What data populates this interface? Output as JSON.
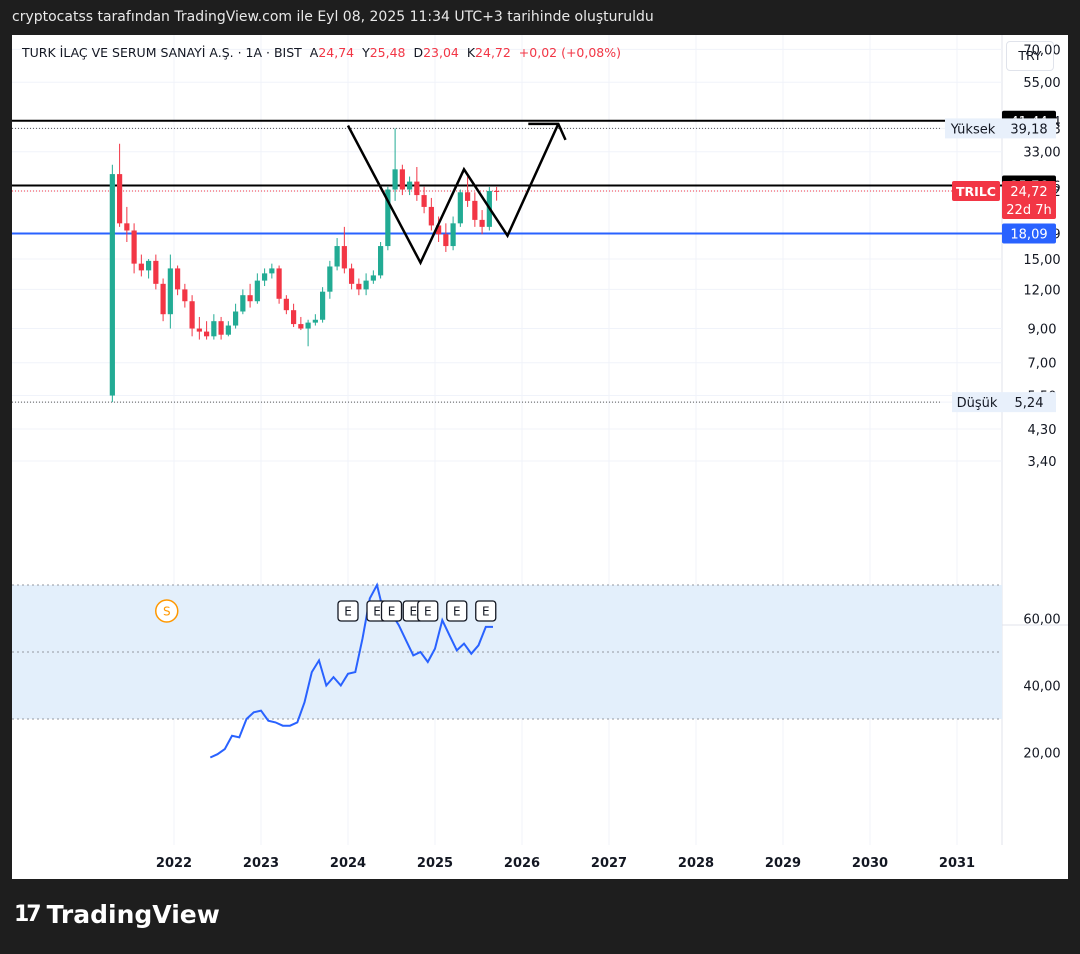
{
  "header": {
    "text": "cryptocatss tarafından TradingView.com ile Eyl 08, 2025 11:34 UTC+3 tarihinde oluşturuldu"
  },
  "legend": {
    "symbol": "TURK İLAÇ VE SERUM SANAYİ A.Ş. · 1A · BIST",
    "a_label": "A",
    "a_val": "24,74",
    "y_label": "Y",
    "y_val": "25,48",
    "d_label": "D",
    "d_val": "23,04",
    "k_label": "K",
    "k_val": "24,72",
    "change": "+0,02 (+0,08%)"
  },
  "currency": "TRY",
  "logo": {
    "mark": "17",
    "text": "TradingView"
  },
  "colors": {
    "up": "#22ab94",
    "down": "#f23645",
    "rsi": "#2962ff",
    "level": "#2962ff",
    "band": "#e3effb"
  },
  "chart_data": [
    {
      "type": "candlestick",
      "title": "TURK İLAÇ VE SERUM SANAYİ A.Ş. · 1A · BIST",
      "interval": "1A",
      "scale": "log",
      "currency": "TRY",
      "y_ticks": [
        "70,00",
        "55,00",
        "41,44",
        "39,18",
        "33,00",
        "25,76",
        "24,72",
        "18,09",
        "15,00",
        "12,00",
        "9,00",
        "7,00",
        "5,50",
        "5,24",
        "4,30",
        "3,40"
      ],
      "x_ticks": [
        "2022",
        "2023",
        "2024",
        "2025",
        "2026",
        "2027",
        "2028",
        "2029",
        "2030",
        "2031"
      ],
      "candles": [
        {
          "t": "2021-04",
          "o": 5.5,
          "h": 30.0,
          "l": 5.24,
          "c": 28.0
        },
        {
          "t": "2021-05",
          "o": 28.0,
          "h": 35.0,
          "l": 19.0,
          "c": 19.5
        },
        {
          "t": "2021-06",
          "o": 19.5,
          "h": 22.0,
          "l": 17.0,
          "c": 18.5
        },
        {
          "t": "2021-07",
          "o": 18.5,
          "h": 19.5,
          "l": 13.5,
          "c": 14.5
        },
        {
          "t": "2021-08",
          "o": 14.5,
          "h": 15.5,
          "l": 13.2,
          "c": 13.8
        },
        {
          "t": "2021-09",
          "o": 13.8,
          "h": 15.0,
          "l": 13.0,
          "c": 14.8
        },
        {
          "t": "2021-10",
          "o": 14.8,
          "h": 15.5,
          "l": 12.0,
          "c": 12.5
        },
        {
          "t": "2021-11",
          "o": 12.5,
          "h": 13.0,
          "l": 9.5,
          "c": 10.0
        },
        {
          "t": "2021-12",
          "o": 10.0,
          "h": 15.5,
          "l": 9.0,
          "c": 14.0
        },
        {
          "t": "2022-01",
          "o": 14.0,
          "h": 14.3,
          "l": 11.5,
          "c": 12.0
        },
        {
          "t": "2022-02",
          "o": 12.0,
          "h": 12.5,
          "l": 10.5,
          "c": 11.0
        },
        {
          "t": "2022-03",
          "o": 11.0,
          "h": 11.5,
          "l": 8.5,
          "c": 9.0
        },
        {
          "t": "2022-04",
          "o": 9.0,
          "h": 9.8,
          "l": 8.3,
          "c": 8.8
        },
        {
          "t": "2022-05",
          "o": 8.8,
          "h": 9.5,
          "l": 8.3,
          "c": 8.5
        },
        {
          "t": "2022-06",
          "o": 8.5,
          "h": 10.0,
          "l": 8.3,
          "c": 9.5
        },
        {
          "t": "2022-07",
          "o": 9.5,
          "h": 9.8,
          "l": 8.3,
          "c": 8.6
        },
        {
          "t": "2022-08",
          "o": 8.6,
          "h": 9.5,
          "l": 8.5,
          "c": 9.2
        },
        {
          "t": "2022-09",
          "o": 9.2,
          "h": 10.8,
          "l": 9.0,
          "c": 10.2
        },
        {
          "t": "2022-10",
          "o": 10.2,
          "h": 12.0,
          "l": 10.0,
          "c": 11.5
        },
        {
          "t": "2022-11",
          "o": 11.5,
          "h": 12.5,
          "l": 10.5,
          "c": 11.0
        },
        {
          "t": "2022-12",
          "o": 11.0,
          "h": 13.5,
          "l": 10.8,
          "c": 12.8
        },
        {
          "t": "2023-01",
          "o": 12.8,
          "h": 14.0,
          "l": 12.3,
          "c": 13.5
        },
        {
          "t": "2023-02",
          "o": 13.5,
          "h": 14.5,
          "l": 13.0,
          "c": 14.0
        },
        {
          "t": "2023-03",
          "o": 14.0,
          "h": 14.3,
          "l": 10.8,
          "c": 11.2
        },
        {
          "t": "2023-04",
          "o": 11.2,
          "h": 11.5,
          "l": 10.0,
          "c": 10.3
        },
        {
          "t": "2023-05",
          "o": 10.3,
          "h": 10.8,
          "l": 9.1,
          "c": 9.3
        },
        {
          "t": "2023-06",
          "o": 9.3,
          "h": 9.8,
          "l": 8.9,
          "c": 9.0
        },
        {
          "t": "2023-07",
          "o": 9.0,
          "h": 9.6,
          "l": 7.9,
          "c": 9.4
        },
        {
          "t": "2023-08",
          "o": 9.4,
          "h": 10.0,
          "l": 9.2,
          "c": 9.6
        },
        {
          "t": "2023-09",
          "o": 9.6,
          "h": 12.2,
          "l": 9.4,
          "c": 11.8
        },
        {
          "t": "2023-10",
          "o": 11.8,
          "h": 14.8,
          "l": 11.2,
          "c": 14.2
        },
        {
          "t": "2023-11",
          "o": 14.2,
          "h": 17.5,
          "l": 13.8,
          "c": 16.5
        },
        {
          "t": "2023-12",
          "o": 16.5,
          "h": 19.0,
          "l": 13.5,
          "c": 14.0
        },
        {
          "t": "2024-01",
          "o": 14.0,
          "h": 14.5,
          "l": 12.0,
          "c": 12.5
        },
        {
          "t": "2024-02",
          "o": 12.5,
          "h": 13.0,
          "l": 11.5,
          "c": 12.0
        },
        {
          "t": "2024-03",
          "o": 12.0,
          "h": 13.5,
          "l": 11.5,
          "c": 12.8
        },
        {
          "t": "2024-04",
          "o": 12.8,
          "h": 13.8,
          "l": 12.5,
          "c": 13.3
        },
        {
          "t": "2024-05",
          "o": 13.3,
          "h": 17.0,
          "l": 13.0,
          "c": 16.5
        },
        {
          "t": "2024-06",
          "o": 16.5,
          "h": 25.5,
          "l": 16.0,
          "c": 25.0
        },
        {
          "t": "2024-07",
          "o": 25.0,
          "h": 39.18,
          "l": 23.0,
          "c": 29.0
        },
        {
          "t": "2024-08",
          "o": 29.0,
          "h": 30.0,
          "l": 24.0,
          "c": 25.0
        },
        {
          "t": "2024-09",
          "o": 25.0,
          "h": 27.5,
          "l": 24.0,
          "c": 26.5
        },
        {
          "t": "2024-10",
          "o": 26.5,
          "h": 29.5,
          "l": 23.0,
          "c": 24.0
        },
        {
          "t": "2024-11",
          "o": 24.0,
          "h": 25.5,
          "l": 21.0,
          "c": 22.0
        },
        {
          "t": "2024-12",
          "o": 22.0,
          "h": 23.5,
          "l": 18.5,
          "c": 19.2
        },
        {
          "t": "2025-01",
          "o": 19.2,
          "h": 20.5,
          "l": 17.0,
          "c": 18.0
        },
        {
          "t": "2025-02",
          "o": 18.0,
          "h": 19.5,
          "l": 15.8,
          "c": 16.5
        },
        {
          "t": "2025-03",
          "o": 16.5,
          "h": 20.5,
          "l": 16.0,
          "c": 19.5
        },
        {
          "t": "2025-04",
          "o": 19.5,
          "h": 25.0,
          "l": 19.0,
          "c": 24.5
        },
        {
          "t": "2025-05",
          "o": 24.5,
          "h": 27.5,
          "l": 22.0,
          "c": 23.0
        },
        {
          "t": "2025-06",
          "o": 23.0,
          "h": 24.5,
          "l": 19.0,
          "c": 20.0
        },
        {
          "t": "2025-07",
          "o": 20.0,
          "h": 21.5,
          "l": 18.0,
          "c": 19.0
        },
        {
          "t": "2025-08",
          "o": 19.0,
          "h": 25.48,
          "l": 18.5,
          "c": 24.74
        },
        {
          "t": "2025-09",
          "o": 24.74,
          "h": 25.48,
          "l": 23.04,
          "c": 24.72
        }
      ],
      "horizontal_lines": [
        {
          "value": 41.44,
          "label": "41,44",
          "color": "#000000"
        },
        {
          "value": 25.76,
          "label": "25,76",
          "color": "#000000"
        },
        {
          "value": 18.09,
          "label": "18,09",
          "color": "#2962ff"
        }
      ],
      "high_low": {
        "high_label": "Yüksek",
        "high_value": 39.18,
        "high_text": "39,18",
        "low_label": "Düşük",
        "low_value": 5.24,
        "low_text": "5,24"
      },
      "last_price": {
        "symbol": "TRILC",
        "value": 24.72,
        "text": "24,72",
        "countdown": "22d 7h"
      },
      "drawing": {
        "type": "W-pattern",
        "points": [
          {
            "t": "2024-01",
            "v": 40.0
          },
          {
            "t": "2024-11",
            "v": 14.6
          },
          {
            "t": "2025-05",
            "v": 29.0
          },
          {
            "t": "2025-11",
            "v": 17.8
          },
          {
            "t": "2026-06",
            "v": 40.5
          }
        ],
        "arrow_head": {
          "t": "2026-07",
          "v": 36.0
        }
      },
      "event_markers": [
        {
          "t": "2021-12",
          "label": "S"
        },
        {
          "t": "2024-01",
          "label": "E"
        },
        {
          "t": "2024-05",
          "label": "E"
        },
        {
          "t": "2024-07",
          "label": "E"
        },
        {
          "t": "2024-10",
          "label": "E"
        },
        {
          "t": "2024-12",
          "label": "E"
        },
        {
          "t": "2025-04",
          "label": "E"
        },
        {
          "t": "2025-08",
          "label": "E"
        }
      ]
    },
    {
      "type": "line",
      "indicator": "RSI",
      "y_ticks": [
        "60,00",
        "40,00",
        "20,00"
      ],
      "band": [
        30,
        70
      ],
      "midline": 50,
      "points": [
        {
          "t": "2022-06",
          "v": 18.5
        },
        {
          "t": "2022-07",
          "v": 19.5
        },
        {
          "t": "2022-08",
          "v": 21.0
        },
        {
          "t": "2022-09",
          "v": 25.0
        },
        {
          "t": "2022-10",
          "v": 24.5
        },
        {
          "t": "2022-11",
          "v": 30.0
        },
        {
          "t": "2022-12",
          "v": 32.0
        },
        {
          "t": "2023-01",
          "v": 32.5
        },
        {
          "t": "2023-02",
          "v": 29.5
        },
        {
          "t": "2023-03",
          "v": 29.0
        },
        {
          "t": "2023-04",
          "v": 28.0
        },
        {
          "t": "2023-05",
          "v": 28.0
        },
        {
          "t": "2023-06",
          "v": 29.0
        },
        {
          "t": "2023-07",
          "v": 35.0
        },
        {
          "t": "2023-08",
          "v": 44.0
        },
        {
          "t": "2023-09",
          "v": 47.5
        },
        {
          "t": "2023-10",
          "v": 40.0
        },
        {
          "t": "2023-11",
          "v": 42.5
        },
        {
          "t": "2023-12",
          "v": 40.0
        },
        {
          "t": "2024-01",
          "v": 43.5
        },
        {
          "t": "2024-02",
          "v": 44.0
        },
        {
          "t": "2024-03",
          "v": 54.0
        },
        {
          "t": "2024-04",
          "v": 66.0
        },
        {
          "t": "2024-05",
          "v": 70.0
        },
        {
          "t": "2024-06",
          "v": 61.0
        },
        {
          "t": "2024-07",
          "v": 61.5
        },
        {
          "t": "2024-08",
          "v": 58.0
        },
        {
          "t": "2024-09",
          "v": 53.5
        },
        {
          "t": "2024-10",
          "v": 49.0
        },
        {
          "t": "2024-11",
          "v": 50.0
        },
        {
          "t": "2024-12",
          "v": 47.0
        },
        {
          "t": "2025-01",
          "v": 51.0
        },
        {
          "t": "2025-02",
          "v": 59.5
        },
        {
          "t": "2025-03",
          "v": 55.0
        },
        {
          "t": "2025-04",
          "v": 50.5
        },
        {
          "t": "2025-05",
          "v": 52.5
        },
        {
          "t": "2025-06",
          "v": 49.5
        },
        {
          "t": "2025-07",
          "v": 52.0
        },
        {
          "t": "2025-08",
          "v": 57.5
        },
        {
          "t": "2025-09",
          "v": 57.5
        }
      ]
    }
  ]
}
